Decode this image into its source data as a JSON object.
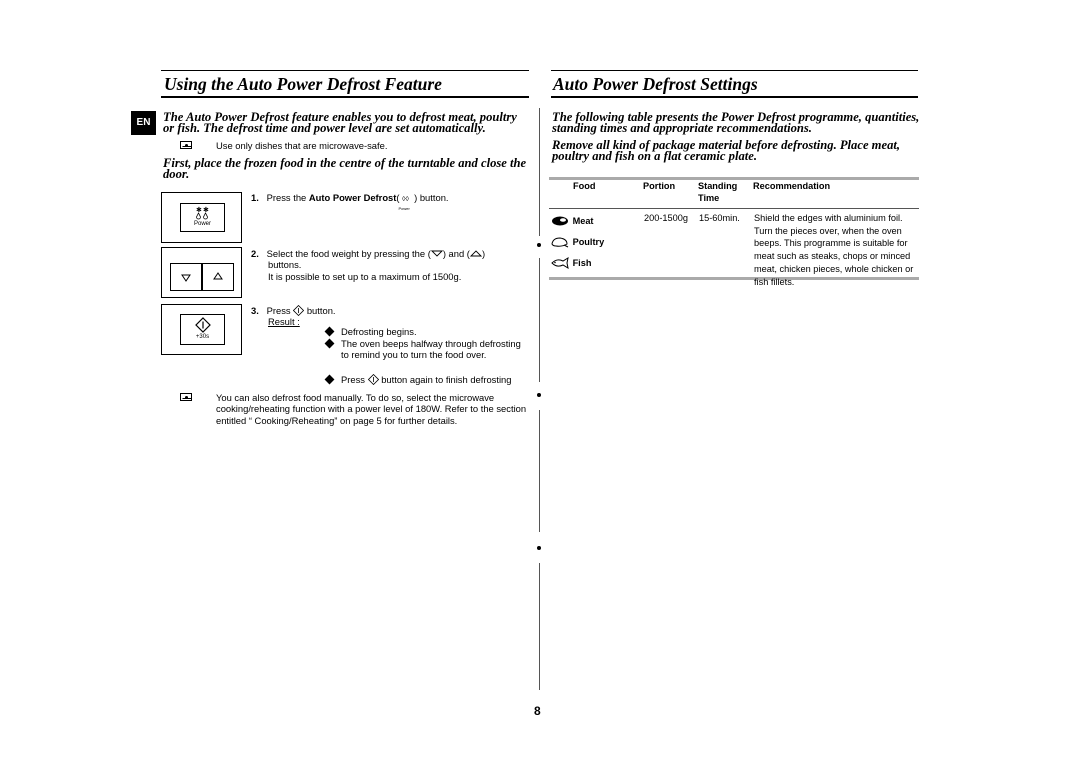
{
  "left": {
    "title": "Using the Auto Power Defrost Feature",
    "lang_badge": "EN",
    "intro": "The Auto Power Defrost feature enables you to defrost meat, poultry or fish. The defrost time and power level are set automatically.",
    "note1": "Use only dishes that are microwave-safe.",
    "lead2": "First, place the frozen food in the centre of the turntable and close the door.",
    "steps": [
      {
        "num": "1.",
        "pre": "Press the ",
        "bold": "Auto Power Defrost",
        "post": " ) button.",
        "icon_label": "Power"
      },
      {
        "num": "2.",
        "line1_pre": "Select the food weight by pressing the (",
        "line1_mid": ") and (",
        "line1_post": ")",
        "line2": "buttons.",
        "line3": "It is possible to set up to a maximum of 1500g."
      },
      {
        "num": "3.",
        "pre": "Press ",
        "post": " button.",
        "result_label": "Result :",
        "results": [
          "Defrosting begins.",
          "The oven beeps halfway through defrosting to remind you to turn the food over.",
          "button again to finish defrosting"
        ],
        "result3_pre": "Press "
      }
    ],
    "panel1_label": "Power",
    "panel3_label": "+30s",
    "note2": "You can also defrost food manually. To do so, select the microwave cooking/reheating function with a power level of 180W. Refer to the section entitled “ Cooking/Reheating” on page 5 for further details."
  },
  "right": {
    "title": "Auto Power Defrost Settings",
    "intro": "The following table presents the Power Defrost programme, quantities, standing times and appropriate recommendations.",
    "lead2": "Remove all kind of package material before defrosting. Place meat, poultry and fish on a flat ceramic plate.",
    "table": {
      "headers": [
        "Food",
        "Portion",
        "Standing Time",
        "Recommendation"
      ],
      "foods": [
        {
          "icon": "meat-icon",
          "label": "Meat"
        },
        {
          "icon": "poultry-icon",
          "label": "Poultry"
        },
        {
          "icon": "fish-icon",
          "label": "Fish"
        }
      ],
      "portion": "200-1500g",
      "standing_time": "15-60min.",
      "recommendation": "Shield the edges with aluminium foil. Turn the pieces over, when the oven beeps. This programme is suitable for meat such as steaks, chops or minced meat, chicken pieces, whole chicken or fish fillets."
    }
  },
  "page_number": "8"
}
